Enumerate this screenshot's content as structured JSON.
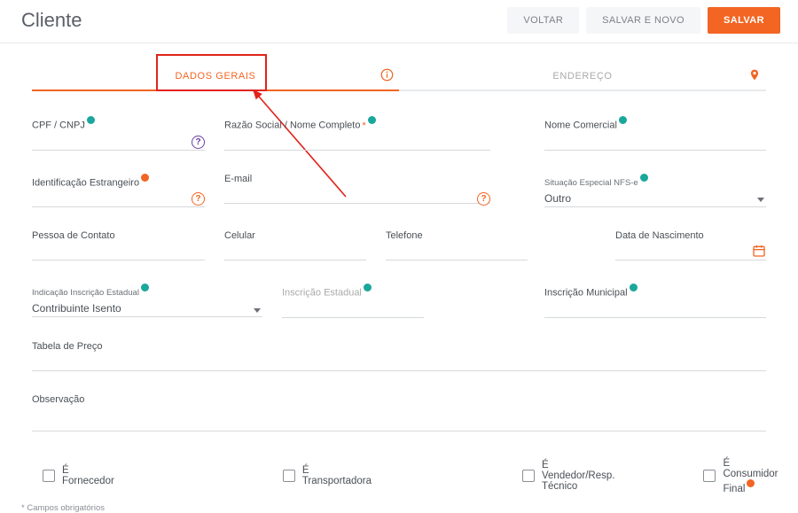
{
  "header": {
    "title": "Cliente",
    "voltar": "VOLTAR",
    "salvar_novo": "SALVAR E NOVO",
    "salvar": "SALVAR"
  },
  "tabs": {
    "dados_gerais": "DADOS GERAIS",
    "endereco": "ENDEREÇO"
  },
  "fields": {
    "cpf_label": "CPF / CNPJ",
    "razao_label": "Razão Social / Nome Completo",
    "nome_comercial_label": "Nome Comercial",
    "id_estrangeiro_label": "Identificação Estrangeiro",
    "email_label": "E-mail",
    "situacao_label": "Situação Especial NFS-e",
    "situacao_value": "Outro",
    "pessoa_contato_label": "Pessoa de Contato",
    "celular_label": "Celular",
    "telefone_label": "Telefone",
    "data_nasc_label": "Data de Nascimento",
    "ind_ie_label": "Indicação Inscrição Estadual",
    "ind_ie_value": "Contribuinte Isento",
    "ie_label": "Inscrição Estadual",
    "im_label": "Inscrição Municipal",
    "tabela_preco_label": "Tabela de Preço",
    "observacao_label": "Observação"
  },
  "checks": {
    "fornecedor": "É Fornecedor",
    "transportadora": "É Transportadora",
    "vendedor": "É Vendedor/Resp. Técnico",
    "consumidor": "É Consumidor Final"
  },
  "footnote": "* Campos obrigatórios"
}
